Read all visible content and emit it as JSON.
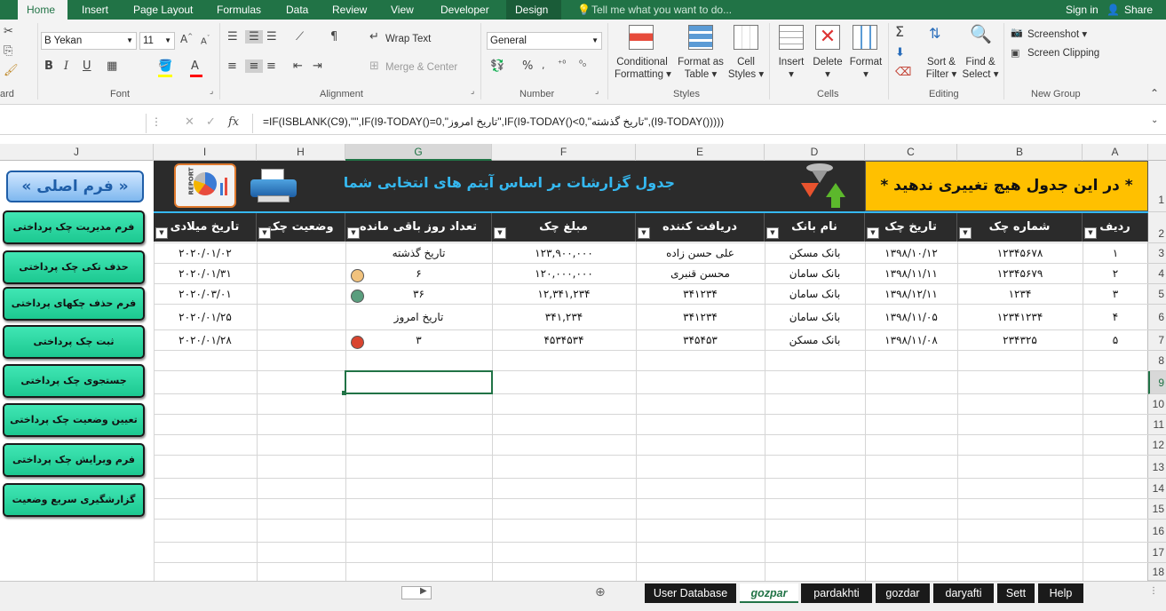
{
  "ribbon_tabs": [
    "Home",
    "Insert",
    "Page Layout",
    "Formulas",
    "Data",
    "Review",
    "View",
    "Developer",
    "Design"
  ],
  "tell_me": "Tell me what you want to do...",
  "sign_in": "Sign in",
  "share": "Share",
  "ribbon": {
    "font_name": "B Yekan",
    "font_size": "11",
    "wrap_text": "Wrap Text",
    "merge_center": "Merge & Center",
    "number_format": "General",
    "conditional_formatting": [
      "Conditional",
      "Formatting"
    ],
    "format_as_table": [
      "Format as",
      "Table"
    ],
    "cell_styles": [
      "Cell",
      "Styles"
    ],
    "insert": "Insert",
    "delete": "Delete",
    "format": "Format",
    "sort_filter": [
      "Sort &",
      "Filter"
    ],
    "find_select": [
      "Find &",
      "Select"
    ],
    "screenshot": "Screenshot",
    "screen_clipping": "Screen Clipping",
    "groups": {
      "clipboard": "ard",
      "font": "Font",
      "alignment": "Alignment",
      "number": "Number",
      "styles": "Styles",
      "cells": "Cells",
      "editing": "Editing",
      "new_group": "New Group"
    }
  },
  "formula_bar": {
    "fx": "fx",
    "formula": "=IF(ISBLANK(C9),\"\",IF(I9-TODAY()=0,\"تاریخ امروز\",IF(I9-TODAY()<0,\"تاریخ گذشته\",(I9-TODAY()))))"
  },
  "columns": [
    "J",
    "I",
    "H",
    "G",
    "F",
    "E",
    "D",
    "C",
    "B",
    "A"
  ],
  "row_numbers": [
    "1",
    "2",
    "3",
    "4",
    "5",
    "6",
    "7",
    "8",
    "9",
    "10",
    "11",
    "12",
    "13",
    "14",
    "15",
    "16",
    "17",
    "18"
  ],
  "banner": {
    "warning": "* در این جدول هیچ تغییری ندهید *",
    "title": "جدول گزارشات بر اساس آیتم های انتخابی شما",
    "report_icon_text": "REPORT"
  },
  "table_headers": {
    "row": "ردیف",
    "check_number": "شماره چک",
    "check_date": "تاریخ چک",
    "bank": "نام بانک",
    "receiver": "دریافت کننده",
    "amount": "مبلغ چک",
    "days_left": "تعداد روز باقی مانده",
    "status": "وضعیت چک",
    "gregorian_date": "تاریخ میلادی"
  },
  "rows": [
    {
      "row": "۱",
      "check_number": "۱۲۳۴۵۶۷۸",
      "check_date": "۱۳۹۸/۱۰/۱۲",
      "bank": "بانک مسکن",
      "receiver": "علی حسن زاده",
      "amount": "۱۲۳,۹۰۰,۰۰۰",
      "days_left": "تاریخ گذشته",
      "gregorian": "۲۰۲۰/۰۱/۰۲",
      "dot": ""
    },
    {
      "row": "۲",
      "check_number": "۱۲۳۴۵۶۷۹",
      "check_date": "۱۳۹۸/۱۱/۱۱",
      "bank": "بانک سامان",
      "receiver": "محسن قنبری",
      "amount": "۱۲۰,۰۰۰,۰۰۰",
      "days_left": "۶",
      "gregorian": "۲۰۲۰/۰۱/۳۱",
      "dot": "#f1c27d"
    },
    {
      "row": "۳",
      "check_number": "۱۲۳۴",
      "check_date": "۱۳۹۸/۱۲/۱۱",
      "bank": "بانک سامان",
      "receiver": "۳۴۱۲۳۴",
      "amount": "۱۲,۳۴۱,۲۳۴",
      "days_left": "۳۶",
      "gregorian": "۲۰۲۰/۰۳/۰۱",
      "dot": "#5a9e7e"
    },
    {
      "row": "۴",
      "check_number": "۱۲۳۴۱۲۳۴",
      "check_date": "۱۳۹۸/۱۱/۰۵",
      "bank": "بانک سامان",
      "receiver": "۳۴۱۲۳۴",
      "amount": "۳۴۱,۲۳۴",
      "days_left": "تاریخ امروز",
      "gregorian": "۲۰۲۰/۰۱/۲۵",
      "dot": ""
    },
    {
      "row": "۵",
      "check_number": "۲۳۴۳۲۵",
      "check_date": "۱۳۹۸/۱۱/۰۸",
      "bank": "بانک مسکن",
      "receiver": "۳۴۵۴۵۳",
      "amount": "۴۵۳۴۵۳۴",
      "days_left": "۳",
      "gregorian": "۲۰۲۰/۰۱/۲۸",
      "dot": "#d9442f"
    }
  ],
  "main_form_button": "« فرم اصلی »",
  "side_buttons": [
    "فرم مدیریت چک پرداختی",
    "حذف تکی چک پرداختی",
    "فرم حذف چکهای پرداختی",
    "ثبت چک پرداختی",
    "جستجوی چک پرداختی",
    "تعیین وضعیت چک پرداختی",
    "فرم ویرایش چک پرداختی",
    "گزارشگیری سریع وضعیت"
  ],
  "sheet_tabs": [
    "User Database",
    "gozpar",
    "pardakhti",
    "gozdar",
    "daryafti",
    "Sett",
    "Help"
  ],
  "active_sheet": "gozpar",
  "colors": {
    "excel_green": "#217346",
    "banner_bg": "#2b2b2b",
    "warning_bg": "#ffc000",
    "title_blue": "#35b8f0",
    "button_green": "#2ad6a0"
  }
}
